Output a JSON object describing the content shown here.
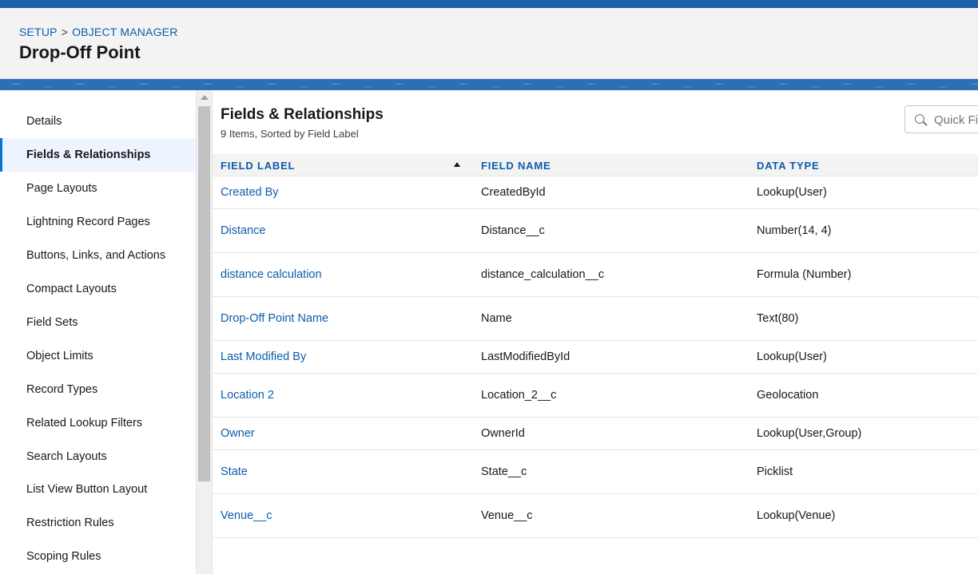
{
  "breadcrumb": {
    "setup": "SETUP",
    "separator": ">",
    "object_manager": "OBJECT MANAGER"
  },
  "page_title": "Drop-Off Point",
  "sidebar": {
    "items": [
      {
        "label": "Details"
      },
      {
        "label": "Fields & Relationships",
        "active": true
      },
      {
        "label": "Page Layouts"
      },
      {
        "label": "Lightning Record Pages"
      },
      {
        "label": "Buttons, Links, and Actions"
      },
      {
        "label": "Compact Layouts"
      },
      {
        "label": "Field Sets"
      },
      {
        "label": "Object Limits"
      },
      {
        "label": "Record Types"
      },
      {
        "label": "Related Lookup Filters"
      },
      {
        "label": "Search Layouts"
      },
      {
        "label": "List View Button Layout"
      },
      {
        "label": "Restriction Rules"
      },
      {
        "label": "Scoping Rules"
      }
    ]
  },
  "content": {
    "title": "Fields & Relationships",
    "subtitle": "9 Items, Sorted by Field Label",
    "quick_find_placeholder": "Quick Find",
    "columns": {
      "field_label": "FIELD LABEL",
      "field_name": "FIELD NAME",
      "data_type": "DATA TYPE"
    },
    "rows": [
      {
        "label": "Created By",
        "name": "CreatedById",
        "type": "Lookup(User)"
      },
      {
        "label": "Distance",
        "name": "Distance__c",
        "type": "Number(14, 4)"
      },
      {
        "label": "distance calculation",
        "name": "distance_calculation__c",
        "type": "Formula (Number)"
      },
      {
        "label": "Drop-Off Point Name",
        "name": "Name",
        "type": "Text(80)"
      },
      {
        "label": "Last Modified By",
        "name": "LastModifiedById",
        "type": "Lookup(User)"
      },
      {
        "label": "Location 2",
        "name": "Location_2__c",
        "type": "Geolocation"
      },
      {
        "label": "Owner",
        "name": "OwnerId",
        "type": "Lookup(User,Group)"
      },
      {
        "label": "State",
        "name": "State__c",
        "type": "Picklist"
      },
      {
        "label": "Venue__c",
        "name": "Venue__c",
        "type": "Lookup(Venue)"
      }
    ]
  },
  "colors": {
    "link": "#0b5cab",
    "brand_band": "#1b5fa8",
    "active_bg": "#eef4ff"
  }
}
